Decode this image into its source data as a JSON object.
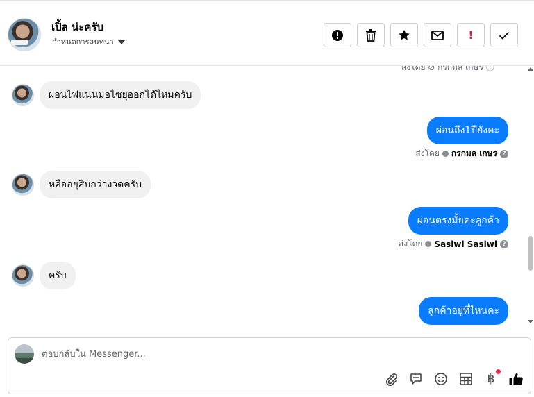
{
  "header": {
    "contact_name": "เปิ้ล น่ะครับ",
    "sub_label": "กำหนดการสนทนา",
    "actions": [
      {
        "name": "alert-icon"
      },
      {
        "name": "trash-icon"
      },
      {
        "name": "star-icon"
      },
      {
        "name": "mail-icon"
      },
      {
        "name": "exclamation-icon",
        "label": "!"
      },
      {
        "name": "check-icon"
      }
    ]
  },
  "thread": {
    "messages": [
      {
        "direction": "in",
        "text": "ผ่อนไฟแนนมอไซยุออกได้ไหมครับ"
      },
      {
        "direction": "out",
        "text": "ผ่อนถึง1ปียังคะ",
        "sent_by_prefix": "ส่งโดย",
        "sent_by": "กรกมล เกษร"
      },
      {
        "direction": "in",
        "text": "หลืออยุสิบกว่างวดครับ"
      },
      {
        "direction": "out",
        "text": "ผ่อนตรงมั้ยคะลูกค้า",
        "sent_by_prefix": "ส่งโดย",
        "sent_by": "Sasiwi Sasiwi"
      },
      {
        "direction": "in",
        "text": "ครับ"
      },
      {
        "direction": "out",
        "text": "ลูกค้าอยู่ที่ไหนคะ"
      }
    ]
  },
  "composer": {
    "placeholder": "ตอบกลับใน Messenger...",
    "tools": [
      "paperclip-icon",
      "chat-bubble-icon",
      "smiley-icon",
      "grid-icon",
      "baht-icon",
      "thumbs-up-icon"
    ],
    "baht_symbol": "฿"
  },
  "colors": {
    "outgoing_bubble": "#0a7cff",
    "incoming_bubble": "#f0f0f0",
    "notification_dot": "#f02849"
  }
}
